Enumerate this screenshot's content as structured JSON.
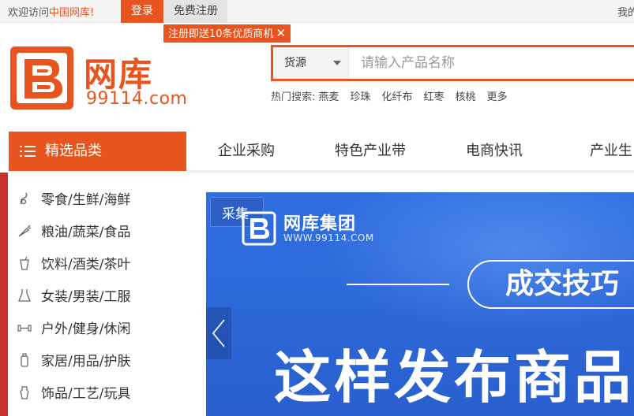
{
  "topbar": {
    "welcome": "欢迎访问",
    "site_name": "中国网库!",
    "login": "登录",
    "register": "免费注册",
    "right_text": "我的"
  },
  "promo": {
    "text": "注册即送10条优质商机"
  },
  "logo": {
    "brand": "网库",
    "sub": "99114.com"
  },
  "search": {
    "category": "货源",
    "placeholder": "请输入产品名称",
    "hot_label": "热门搜索:",
    "hot_keywords": [
      "燕麦",
      "珍珠",
      "化纤布",
      "红枣",
      "核桃",
      "更多"
    ]
  },
  "nav": {
    "category_title": "精选品类",
    "items": [
      "企业采购",
      "特色产业带",
      "电商快讯",
      "产业生"
    ]
  },
  "sidebar": {
    "items": [
      {
        "label": "零食/生鲜/海鲜",
        "icon": "snack-icon"
      },
      {
        "label": "粮油/蔬菜/食品",
        "icon": "carrot-icon"
      },
      {
        "label": "饮料/酒类/茶叶",
        "icon": "drink-icon"
      },
      {
        "label": "女装/男装/工服",
        "icon": "dress-icon"
      },
      {
        "label": "户外/健身/休闲",
        "icon": "dumbbell-icon"
      },
      {
        "label": "家居/用品/护肤",
        "icon": "bottle-icon"
      },
      {
        "label": "饰品/工艺/玩具",
        "icon": "ornament-icon"
      }
    ]
  },
  "banner": {
    "tag": "采集",
    "brand": "网库集团",
    "url": "WWW.99114.COM",
    "pill_text": "成交技巧",
    "headline": "这样发布商品"
  },
  "colors": {
    "accent": "#e8541e",
    "banner": "#2f6fe0"
  }
}
